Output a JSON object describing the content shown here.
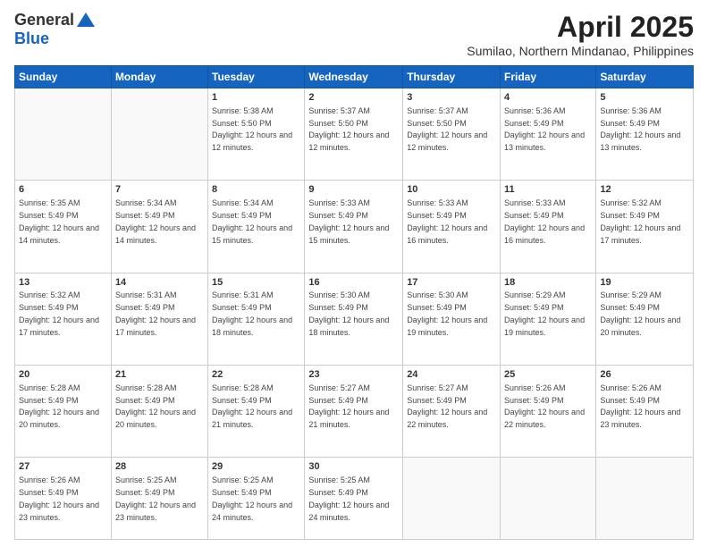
{
  "logo": {
    "general": "General",
    "blue": "Blue"
  },
  "title": {
    "month": "April 2025",
    "location": "Sumilao, Northern Mindanao, Philippines"
  },
  "weekdays": [
    "Sunday",
    "Monday",
    "Tuesday",
    "Wednesday",
    "Thursday",
    "Friday",
    "Saturday"
  ],
  "days": {
    "1": {
      "sunrise": "5:38 AM",
      "sunset": "5:50 PM",
      "daylight": "12 hours and 12 minutes."
    },
    "2": {
      "sunrise": "5:37 AM",
      "sunset": "5:50 PM",
      "daylight": "12 hours and 12 minutes."
    },
    "3": {
      "sunrise": "5:37 AM",
      "sunset": "5:50 PM",
      "daylight": "12 hours and 12 minutes."
    },
    "4": {
      "sunrise": "5:36 AM",
      "sunset": "5:49 PM",
      "daylight": "12 hours and 13 minutes."
    },
    "5": {
      "sunrise": "5:36 AM",
      "sunset": "5:49 PM",
      "daylight": "12 hours and 13 minutes."
    },
    "6": {
      "sunrise": "5:35 AM",
      "sunset": "5:49 PM",
      "daylight": "12 hours and 14 minutes."
    },
    "7": {
      "sunrise": "5:34 AM",
      "sunset": "5:49 PM",
      "daylight": "12 hours and 14 minutes."
    },
    "8": {
      "sunrise": "5:34 AM",
      "sunset": "5:49 PM",
      "daylight": "12 hours and 15 minutes."
    },
    "9": {
      "sunrise": "5:33 AM",
      "sunset": "5:49 PM",
      "daylight": "12 hours and 15 minutes."
    },
    "10": {
      "sunrise": "5:33 AM",
      "sunset": "5:49 PM",
      "daylight": "12 hours and 16 minutes."
    },
    "11": {
      "sunrise": "5:33 AM",
      "sunset": "5:49 PM",
      "daylight": "12 hours and 16 minutes."
    },
    "12": {
      "sunrise": "5:32 AM",
      "sunset": "5:49 PM",
      "daylight": "12 hours and 17 minutes."
    },
    "13": {
      "sunrise": "5:32 AM",
      "sunset": "5:49 PM",
      "daylight": "12 hours and 17 minutes."
    },
    "14": {
      "sunrise": "5:31 AM",
      "sunset": "5:49 PM",
      "daylight": "12 hours and 17 minutes."
    },
    "15": {
      "sunrise": "5:31 AM",
      "sunset": "5:49 PM",
      "daylight": "12 hours and 18 minutes."
    },
    "16": {
      "sunrise": "5:30 AM",
      "sunset": "5:49 PM",
      "daylight": "12 hours and 18 minutes."
    },
    "17": {
      "sunrise": "5:30 AM",
      "sunset": "5:49 PM",
      "daylight": "12 hours and 19 minutes."
    },
    "18": {
      "sunrise": "5:29 AM",
      "sunset": "5:49 PM",
      "daylight": "12 hours and 19 minutes."
    },
    "19": {
      "sunrise": "5:29 AM",
      "sunset": "5:49 PM",
      "daylight": "12 hours and 20 minutes."
    },
    "20": {
      "sunrise": "5:28 AM",
      "sunset": "5:49 PM",
      "daylight": "12 hours and 20 minutes."
    },
    "21": {
      "sunrise": "5:28 AM",
      "sunset": "5:49 PM",
      "daylight": "12 hours and 20 minutes."
    },
    "22": {
      "sunrise": "5:28 AM",
      "sunset": "5:49 PM",
      "daylight": "12 hours and 21 minutes."
    },
    "23": {
      "sunrise": "5:27 AM",
      "sunset": "5:49 PM",
      "daylight": "12 hours and 21 minutes."
    },
    "24": {
      "sunrise": "5:27 AM",
      "sunset": "5:49 PM",
      "daylight": "12 hours and 22 minutes."
    },
    "25": {
      "sunrise": "5:26 AM",
      "sunset": "5:49 PM",
      "daylight": "12 hours and 22 minutes."
    },
    "26": {
      "sunrise": "5:26 AM",
      "sunset": "5:49 PM",
      "daylight": "12 hours and 23 minutes."
    },
    "27": {
      "sunrise": "5:26 AM",
      "sunset": "5:49 PM",
      "daylight": "12 hours and 23 minutes."
    },
    "28": {
      "sunrise": "5:25 AM",
      "sunset": "5:49 PM",
      "daylight": "12 hours and 23 minutes."
    },
    "29": {
      "sunrise": "5:25 AM",
      "sunset": "5:49 PM",
      "daylight": "12 hours and 24 minutes."
    },
    "30": {
      "sunrise": "5:25 AM",
      "sunset": "5:49 PM",
      "daylight": "12 hours and 24 minutes."
    }
  }
}
